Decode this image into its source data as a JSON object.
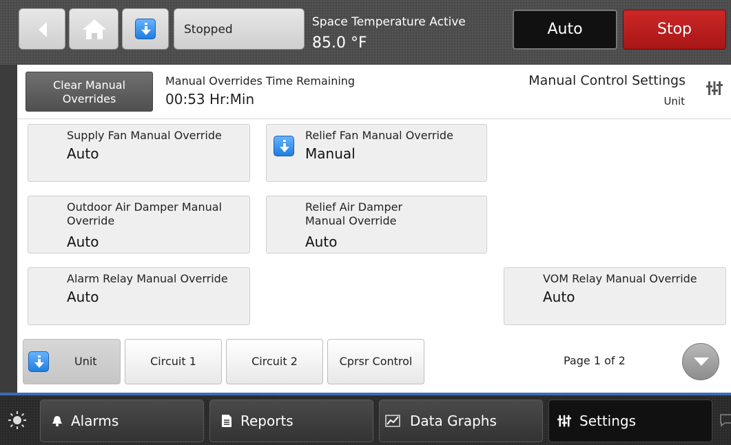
{
  "header": {
    "status_label": "Stopped",
    "space_temp_label": "Space Temperature Active",
    "space_temp_value": "85.0 °F",
    "auto_label": "Auto",
    "stop_label": "Stop"
  },
  "overrides": {
    "clear_label": "Clear Manual Overrides",
    "remaining_label": "Manual Overrides Time Remaining",
    "remaining_value": "00:53 Hr:Min",
    "section_title": "Manual Control Settings",
    "section_sub": "Unit"
  },
  "cards": [
    {
      "label": "Supply Fan Manual Override",
      "value": "Auto"
    },
    {
      "label": "Relief Fan Manual Override",
      "value": "Manual"
    },
    {
      "label": "Outdoor Air Damper Manual Override",
      "value": "Auto"
    },
    {
      "label": "Relief Air Damper Manual Override",
      "value": "Auto"
    },
    {
      "label": "Alarm Relay Manual Override",
      "value": "Auto"
    },
    {
      "label": "VOM Relay Manual Override",
      "value": "Auto"
    }
  ],
  "tabs": [
    {
      "label": "Unit"
    },
    {
      "label": "Circuit 1"
    },
    {
      "label": "Circuit 2"
    },
    {
      "label": "Cprsr Control"
    }
  ],
  "pagination": {
    "label": "Page 1 of 2"
  },
  "bottom_nav": [
    {
      "label": "Alarms",
      "icon": "bell-icon"
    },
    {
      "label": "Reports",
      "icon": "document-icon"
    },
    {
      "label": "Data Graphs",
      "icon": "chart-icon"
    },
    {
      "label": "Settings",
      "icon": "sliders-icon"
    }
  ],
  "colors": {
    "stop": "#b81c1c",
    "accent_blue": "#2b86e8",
    "nav_strip": "#3a6db8"
  }
}
